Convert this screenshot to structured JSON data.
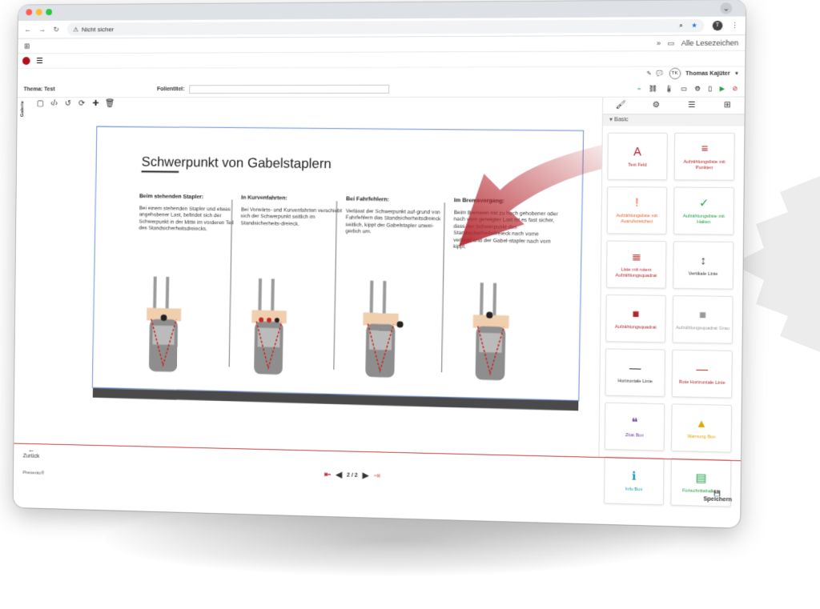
{
  "browser": {
    "security_label": "Nicht sicher",
    "profile_initial": "T",
    "bookmarks_label": "Alle Lesezeichen",
    "dot_colors": [
      "#ff5f57",
      "#febc2e",
      "#28c840"
    ]
  },
  "app": {
    "topic_label": "Thema: Test",
    "slide_title_label": "Folientitel:",
    "user_initials": "TK",
    "user_name": "Thomas Kajüter",
    "gallery_label": "Galerie",
    "back_label": "Zurück",
    "brand_label": "Prevenio®",
    "pager_label": "2 / 2",
    "save_label": "Speichern"
  },
  "slide": {
    "title": "Schwerpunkt von Gabelstaplern",
    "columns": [
      {
        "heading": "Beim stehenden Stapler:",
        "text": "Bei einem stehenden Stapler und etwas angehobener Last, befindet sich der Schwerpunkt in der Mitte im vorderen Teil des Standsicherheitsdreiecks."
      },
      {
        "heading": "In Kurvenfahrten:",
        "text": "Bei Vorwärts- und Kurvenfahrten verschiebt sich der Schwerpunkt seitlich im Standsicherheits-dreieck."
      },
      {
        "heading": "Bei Fahrfehlern:",
        "text": "Verlässt der Schwerpunkt auf-grund von Fahrfehlern das Standsicherheitsdreieck seitlich, kippt der Gabelstapler unwei-gerlich um."
      },
      {
        "heading": "Im Bremsvorgang:",
        "text": "Beim Bremsen mit zu hoch gehobener oder nach vorn geneigter Last ist es fast sicher, dass der Schwerpunkt das Standsicherheitsdreieck nach vorne verlässt und der Gabel-stapler nach vorn kippt."
      }
    ]
  },
  "panel": {
    "section_label": "Basic",
    "tiles": [
      {
        "label": "Text Feld",
        "icon": "A",
        "color": "#b3262d"
      },
      {
        "label": "Aufzählungsliste mit Punkten",
        "icon": "≡",
        "color": "#b3262d"
      },
      {
        "label": "Aufzählungsliste mit Ausrufezeichen",
        "icon": "!",
        "color": "#e8612c"
      },
      {
        "label": "Aufzählungsliste mit Haken",
        "icon": "✓",
        "color": "#1e9c45"
      },
      {
        "label": "Liste mit rotem Aufzählungsquadrat",
        "icon": "≣",
        "color": "#b3262d"
      },
      {
        "label": "Vertikale Linie",
        "icon": "↕",
        "color": "#333333"
      },
      {
        "label": "Aufzählungsquadrat",
        "icon": "■",
        "color": "#b3262d"
      },
      {
        "label": "Aufzählungsquadrat Grau",
        "icon": "■",
        "color": "#999999"
      },
      {
        "label": "Horizontale Linie",
        "icon": "—",
        "color": "#333333"
      },
      {
        "label": "Rote Horizontale Linie",
        "icon": "—",
        "color": "#b3262d"
      },
      {
        "label": "Zitat Box",
        "icon": "❝",
        "color": "#6b3fa0"
      },
      {
        "label": "Warnung Box",
        "icon": "▲",
        "color": "#e0a800"
      },
      {
        "label": "Info Box",
        "icon": "ℹ",
        "color": "#1799b8"
      },
      {
        "label": "Fortschrittsbalken",
        "icon": "▤",
        "color": "#1e9c45"
      }
    ]
  }
}
